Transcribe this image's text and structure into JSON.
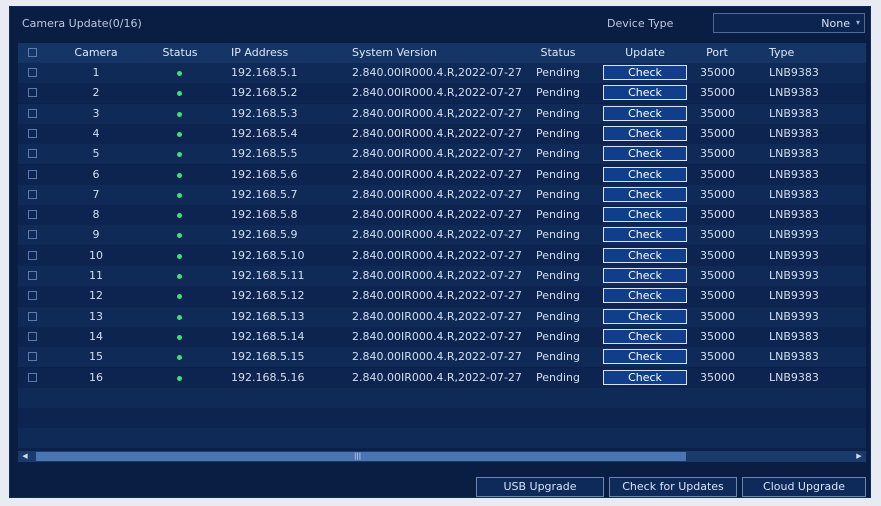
{
  "header": {
    "title": "Camera Update(0/16)",
    "device_type_label": "Device Type",
    "device_type_value": "None"
  },
  "columns": {
    "camera": "Camera",
    "status": "Status",
    "ip": "IP Address",
    "system_version": "System Version",
    "status2": "Status",
    "update": "Update",
    "port": "Port",
    "type": "Type"
  },
  "rows": [
    {
      "camera": "1",
      "ip": "192.168.5.1",
      "version": "2.840.00IR000.4.R,2022-07-27",
      "status": "Pending",
      "update": "Check",
      "port": "35000",
      "type": "LNB9383"
    },
    {
      "camera": "2",
      "ip": "192.168.5.2",
      "version": "2.840.00IR000.4.R,2022-07-27",
      "status": "Pending",
      "update": "Check",
      "port": "35000",
      "type": "LNB9383"
    },
    {
      "camera": "3",
      "ip": "192.168.5.3",
      "version": "2.840.00IR000.4.R,2022-07-27",
      "status": "Pending",
      "update": "Check",
      "port": "35000",
      "type": "LNB9383"
    },
    {
      "camera": "4",
      "ip": "192.168.5.4",
      "version": "2.840.00IR000.4.R,2022-07-27",
      "status": "Pending",
      "update": "Check",
      "port": "35000",
      "type": "LNB9383"
    },
    {
      "camera": "5",
      "ip": "192.168.5.5",
      "version": "2.840.00IR000.4.R,2022-07-27",
      "status": "Pending",
      "update": "Check",
      "port": "35000",
      "type": "LNB9383"
    },
    {
      "camera": "6",
      "ip": "192.168.5.6",
      "version": "2.840.00IR000.4.R,2022-07-27",
      "status": "Pending",
      "update": "Check",
      "port": "35000",
      "type": "LNB9383"
    },
    {
      "camera": "7",
      "ip": "192.168.5.7",
      "version": "2.840.00IR000.4.R,2022-07-27",
      "status": "Pending",
      "update": "Check",
      "port": "35000",
      "type": "LNB9383"
    },
    {
      "camera": "8",
      "ip": "192.168.5.8",
      "version": "2.840.00IR000.4.R,2022-07-27",
      "status": "Pending",
      "update": "Check",
      "port": "35000",
      "type": "LNB9383"
    },
    {
      "camera": "9",
      "ip": "192.168.5.9",
      "version": "2.840.00IR000.4.R,2022-07-27",
      "status": "Pending",
      "update": "Check",
      "port": "35000",
      "type": "LNB9393"
    },
    {
      "camera": "10",
      "ip": "192.168.5.10",
      "version": "2.840.00IR000.4.R,2022-07-27",
      "status": "Pending",
      "update": "Check",
      "port": "35000",
      "type": "LNB9393"
    },
    {
      "camera": "11",
      "ip": "192.168.5.11",
      "version": "2.840.00IR000.4.R,2022-07-27",
      "status": "Pending",
      "update": "Check",
      "port": "35000",
      "type": "LNB9393"
    },
    {
      "camera": "12",
      "ip": "192.168.5.12",
      "version": "2.840.00IR000.4.R,2022-07-27",
      "status": "Pending",
      "update": "Check",
      "port": "35000",
      "type": "LNB9393"
    },
    {
      "camera": "13",
      "ip": "192.168.5.13",
      "version": "2.840.00IR000.4.R,2022-07-27",
      "status": "Pending",
      "update": "Check",
      "port": "35000",
      "type": "LNB9393"
    },
    {
      "camera": "14",
      "ip": "192.168.5.14",
      "version": "2.840.00IR000.4.R,2022-07-27",
      "status": "Pending",
      "update": "Check",
      "port": "35000",
      "type": "LNB9383"
    },
    {
      "camera": "15",
      "ip": "192.168.5.15",
      "version": "2.840.00IR000.4.R,2022-07-27",
      "status": "Pending",
      "update": "Check",
      "port": "35000",
      "type": "LNB9383"
    },
    {
      "camera": "16",
      "ip": "192.168.5.16",
      "version": "2.840.00IR000.4.R,2022-07-27",
      "status": "Pending",
      "update": "Check",
      "port": "35000",
      "type": "LNB9383"
    }
  ],
  "footer": {
    "usb_upgrade": "USB Upgrade",
    "check_updates": "Check for Updates",
    "cloud_upgrade": "Cloud Upgrade"
  },
  "colors": {
    "panel_bg": "#0a1e44",
    "online_dot": "#3fe07a",
    "check_button": "#103e8a"
  },
  "icons": {
    "online": "status-dot-icon",
    "dropdown": "chevron-down-icon",
    "scroll_left": "arrow-left-icon",
    "scroll_right": "arrow-right-icon"
  }
}
